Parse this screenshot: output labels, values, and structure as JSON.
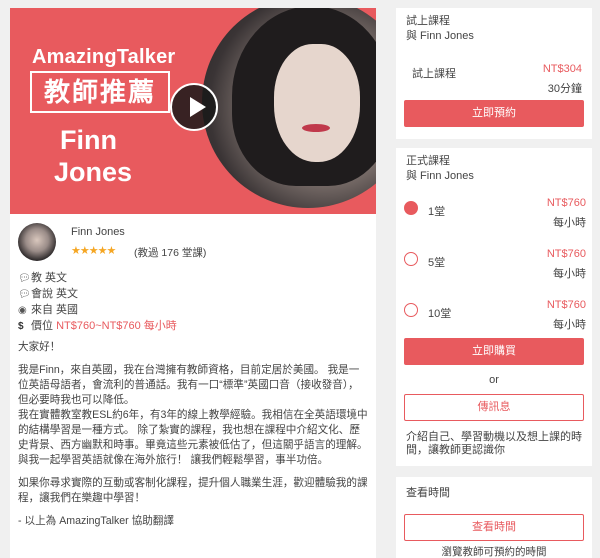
{
  "video": {
    "brand": "AmazingTalker",
    "badge": "教師推薦",
    "name_first": "Finn",
    "name_last": "Jones"
  },
  "tutor": {
    "name": "Finn Jones",
    "rating_stars": "★★★★★",
    "lessons": "(教過 176 堂課)"
  },
  "info": {
    "teaches": "教 英文",
    "speaks": "會說 英文",
    "from": "來自 英國",
    "price_label": "價位",
    "price": "NT$760~NT$760 每小時"
  },
  "bio": {
    "greeting": "大家好！",
    "p1": "我是Finn，來自英國，我在台灣擁有教師資格，目前定居於美國。 我是一位英語母語者，會流利的普通話。我有一口“標準”英國口音（接收發音），但必要時我也可以降低。",
    "p2": "我在實體教室教ESL約6年，有3年的線上教學經驗。我相信在全英語環境中的結構學習是一種方式。 除了紮實的課程，我也想在課程中介紹文化、歷史背景、西方幽默和時事。畢竟這些元素被低估了，但這關乎語言的理解。與我一起學習英語就像在海外旅行！ 讓我們輕鬆學習，事半功倍。",
    "p3": "如果你尋求實際的互動或客制化課程，提升個人職業生涯，歡迎體驗我的課程，讓我們在樂趣中學習！",
    "footer": "- 以上為 AmazingTalker 協助翻譯"
  },
  "trial": {
    "title": "試上課程",
    "subtitle": "與 Finn Jones",
    "label": "試上課程",
    "price": "NT$304",
    "duration": "30分鐘",
    "button": "立即預約"
  },
  "formal": {
    "title": "正式課程",
    "subtitle": "與 Finn Jones",
    "options": [
      {
        "label": "1堂",
        "price": "NT$760",
        "per": "每小時",
        "selected": true
      },
      {
        "label": "5堂",
        "price": "NT$760",
        "per": "每小時",
        "selected": false
      },
      {
        "label": "10堂",
        "price": "NT$760",
        "per": "每小時",
        "selected": false
      }
    ],
    "buy_button": "立即購買",
    "or_text": "or",
    "message_button": "傳訊息",
    "description": "介紹自己、學習動機以及想上課的時間，讓教師更認識你"
  },
  "schedule": {
    "title": "查看時間",
    "button": "查看時間",
    "note": "瀏覽教師可預約的時間"
  },
  "colors": {
    "accent": "#e85a5e",
    "star": "#f5a623"
  }
}
